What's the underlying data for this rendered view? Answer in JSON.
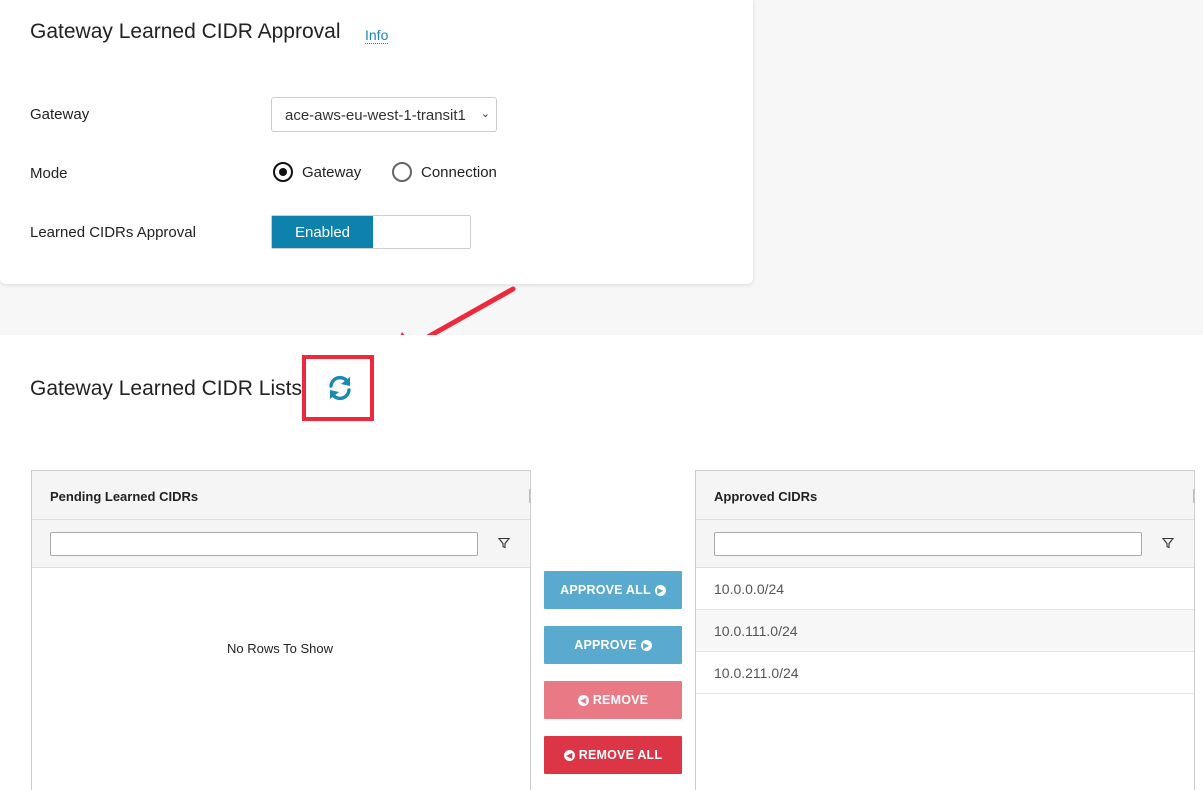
{
  "approval_card": {
    "title": "Gateway Learned CIDR Approval",
    "info_link": "Info",
    "gateway_label": "Gateway",
    "gateway_value": "ace-aws-eu-west-1-transit1",
    "mode_label": "Mode",
    "mode_options": [
      {
        "label": "Gateway",
        "selected": true
      },
      {
        "label": "Connection",
        "selected": false
      }
    ],
    "approval_label": "Learned CIDRs Approval",
    "approval_toggle": "Enabled"
  },
  "lists_card": {
    "title": "Gateway Learned CIDR Lists",
    "refresh_icon": "refresh-icon",
    "pending": {
      "header": "Pending Learned CIDRs",
      "filter_value": "",
      "empty_text": "No Rows To Show"
    },
    "approved": {
      "header": "Approved CIDRs",
      "filter_value": "",
      "rows": [
        "10.0.0.0/24",
        "10.0.111.0/24",
        "10.0.211.0/24"
      ]
    },
    "buttons": {
      "approve_all": "APPROVE ALL",
      "approve": "APPROVE",
      "remove": "REMOVE",
      "remove_all": "REMOVE ALL"
    }
  },
  "colors": {
    "accent": "#0f81ad",
    "approve_btn": "#5aa9cf",
    "remove_btn": "#e97a85",
    "remove_all_btn": "#dc3545",
    "annotation": "#f0283c"
  }
}
